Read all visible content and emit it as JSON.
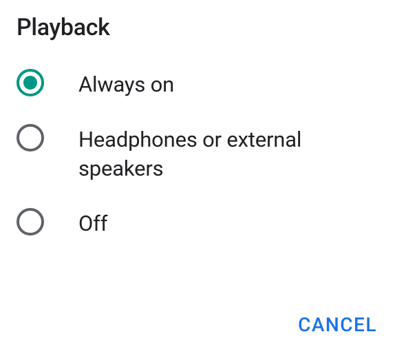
{
  "dialog": {
    "title": "Playback",
    "options": [
      {
        "label": "Always on",
        "selected": true
      },
      {
        "label": "Headphones or external speakers",
        "selected": false
      },
      {
        "label": "Off",
        "selected": false
      }
    ],
    "cancel_label": "CANCEL"
  }
}
